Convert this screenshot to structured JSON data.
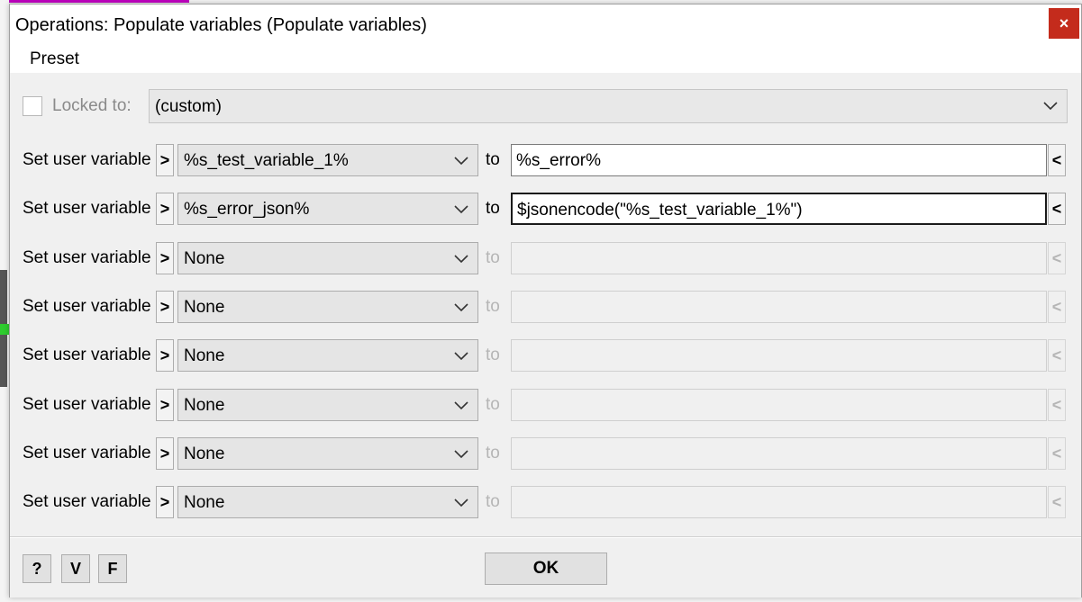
{
  "window": {
    "title": "Operations: Populate variables (Populate variables)",
    "close_glyph": "×"
  },
  "menu": {
    "preset": "Preset"
  },
  "locked": {
    "label": "Locked to:",
    "checked": false,
    "value": "(custom)"
  },
  "rows": [
    {
      "label": "Set user variable",
      "arrow": ">",
      "variable": "%s_test_variable_1%",
      "to": "to",
      "value": "%s_error%",
      "back": "<",
      "enabled": true,
      "focused": false
    },
    {
      "label": "Set user variable",
      "arrow": ">",
      "variable": "%s_error_json%",
      "to": "to",
      "value": "$jsonencode(\"%s_test_variable_1%\")",
      "back": "<",
      "enabled": true,
      "focused": true
    },
    {
      "label": "Set user variable",
      "arrow": ">",
      "variable": "None",
      "to": "to",
      "value": "",
      "back": "<",
      "enabled": false,
      "focused": false
    },
    {
      "label": "Set user variable",
      "arrow": ">",
      "variable": "None",
      "to": "to",
      "value": "",
      "back": "<",
      "enabled": false,
      "focused": false
    },
    {
      "label": "Set user variable",
      "arrow": ">",
      "variable": "None",
      "to": "to",
      "value": "",
      "back": "<",
      "enabled": false,
      "focused": false
    },
    {
      "label": "Set user variable",
      "arrow": ">",
      "variable": "None",
      "to": "to",
      "value": "",
      "back": "<",
      "enabled": false,
      "focused": false
    },
    {
      "label": "Set user variable",
      "arrow": ">",
      "variable": "None",
      "to": "to",
      "value": "",
      "back": "<",
      "enabled": false,
      "focused": false
    },
    {
      "label": "Set user variable",
      "arrow": ">",
      "variable": "None",
      "to": "to",
      "value": "",
      "back": "<",
      "enabled": false,
      "focused": false
    }
  ],
  "footer": {
    "help": "?",
    "v": "V",
    "f": "F",
    "ok": "OK"
  },
  "colors": {
    "close_button": "#c42b1c",
    "dialog_body": "#f0f0f0"
  }
}
